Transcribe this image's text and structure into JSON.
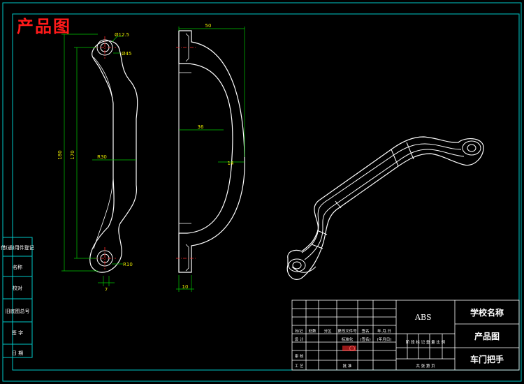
{
  "drawing_title": "产品图",
  "colors": {
    "background": "#000000",
    "border": "#00c8c8",
    "outline": "#ffffff",
    "dimension": "#00c800",
    "dim_text": "#e8e800",
    "title_text": "#ff1a1a",
    "centerline": "#ff2a2a",
    "table_line": "#ffffff"
  },
  "dimensions": {
    "hole_small": "Ø12.5",
    "hole_large": "Ø45",
    "length_overall": "180",
    "hole_spacing": "170",
    "grip_width": "R30",
    "radius_end": "R10",
    "end_width": "7",
    "side_width": "50",
    "side_offset": "36",
    "side_thickness": "14",
    "foot_thickness": "10"
  },
  "left_strip": [
    "借(通)用件登记",
    "名称",
    "校对",
    "旧底图总号",
    "签 字",
    "日 期"
  ],
  "title_block": {
    "material": "ABS",
    "school": "学校名称",
    "drawing_name": "产品图",
    "part_name": "车门把手",
    "row_labels": {
      "mark": "标记",
      "count": "处数",
      "zone": "分区",
      "change_no": "更改文件号",
      "sign": "签名",
      "date": "年.月.日"
    },
    "design": "设 计",
    "review": "审 核",
    "process": "工 艺",
    "standardization": "标准化",
    "signature": "(签名)",
    "date": "(年月日)",
    "approve": "批 准",
    "stage_header": "阶 段 标 记  重 量  比 例",
    "sheets": "共   张   第   页"
  }
}
